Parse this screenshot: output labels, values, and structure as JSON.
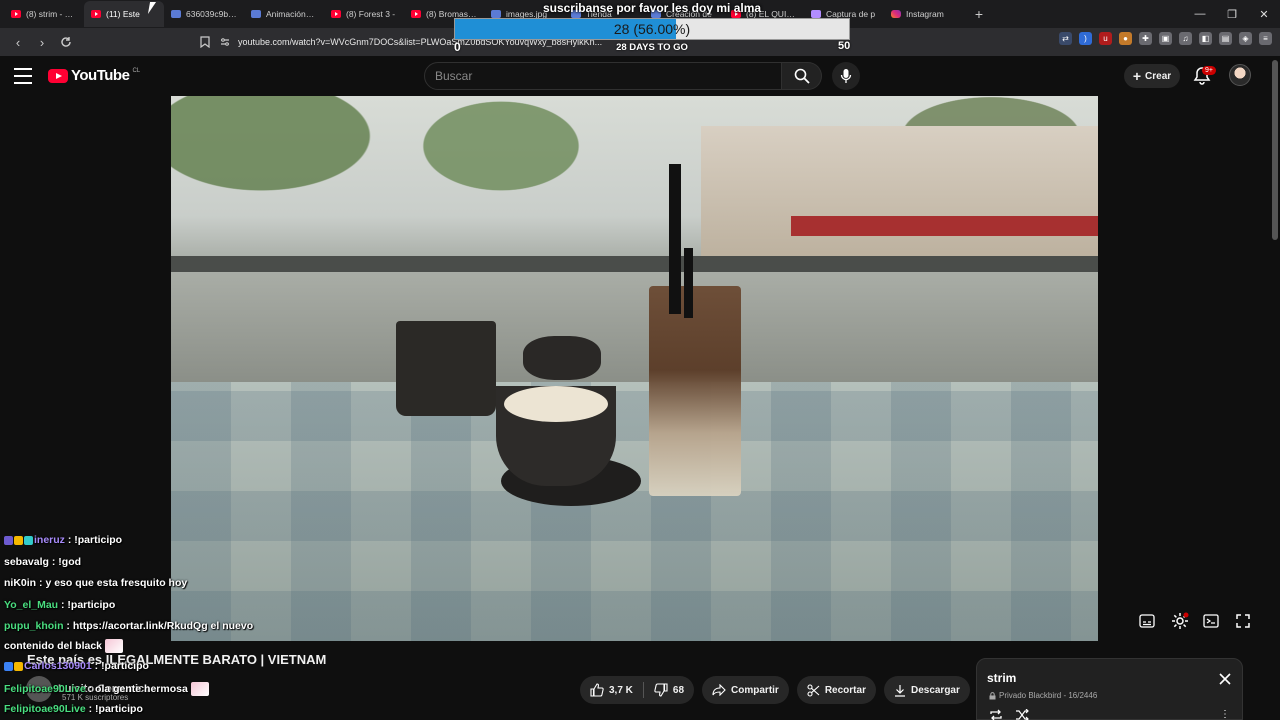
{
  "browser": {
    "tabs": [
      {
        "label": "(8) strim - You",
        "icon": "youtube-icon",
        "active": false
      },
      {
        "label": "(11) Este",
        "icon": "youtube-icon",
        "active": true
      },
      {
        "label": "636039c9b36",
        "icon": "generic-page-icon",
        "active": false
      },
      {
        "label": "Animación_Fr",
        "icon": "generic-page-icon",
        "active": false
      },
      {
        "label": "(8) Forest 3 -",
        "icon": "youtube-icon",
        "active": false
      },
      {
        "label": "(8) Bromas Pe",
        "icon": "youtube-icon",
        "active": false
      },
      {
        "label": "images.jpg",
        "icon": "generic-page-icon",
        "active": false
      },
      {
        "label": "Tienda",
        "icon": "generic-page-icon",
        "active": false
      },
      {
        "label": "Creación de",
        "icon": "generic-page-icon",
        "active": false
      },
      {
        "label": "(8) EL QUISCO",
        "icon": "youtube-icon",
        "active": false
      },
      {
        "label": "Captura de p",
        "icon": "pen-icon",
        "active": false
      },
      {
        "label": "Instagram",
        "icon": "instagram-icon",
        "active": false
      }
    ],
    "new_tab": "+",
    "url": "youtube.com/watch?v=WVcGnm7DOCs&list=PLWOaSmZ0bdSOKYouvqWxy_b8sHyikKn..."
  },
  "overlay": {
    "title": "suscribanse por favor les doy mi alma",
    "progress_text": "28 (56.00%)",
    "progress_fraction": 0.56,
    "min": "0",
    "max": "50",
    "days": "28 DAYS TO GO"
  },
  "youtube": {
    "logo_text": "YouTube",
    "country": "CL",
    "search_placeholder": "Buscar",
    "create_label": "Crear",
    "notifications": "9+"
  },
  "video": {
    "title": "Este país es ILEGALMENTE BARATO | VIETNAM",
    "channel": "Luisito Comunica",
    "subscribers": "571 K suscriptores",
    "likes": "3,7 K",
    "dislikes": "68",
    "share_label": "Compartir",
    "clip_label": "Recortar",
    "download_label": "Descargar"
  },
  "playlist": {
    "title": "strim",
    "meta": "Privado Blackbird - 16/2446"
  },
  "chat": [
    {
      "user": "ineruz",
      "color": "#a78bfa",
      "text": "!participo",
      "badges": [
        "#6d5bd0",
        "#f5b800",
        "#3cc"
      ]
    },
    {
      "user": "sebavalg",
      "color": "#ffffff",
      "text": "!god",
      "badges": []
    },
    {
      "user": "niK0in",
      "color": "#ffffff",
      "text": "y eso que esta fresquito hoy",
      "badges": []
    },
    {
      "user": "Yo_el_Mau",
      "color": "#4ade80",
      "text": "!participo",
      "badges": []
    },
    {
      "user": "pupu_khoin",
      "color": "#4ade80",
      "text": "https://acortar.link/RkudQg el nuevo",
      "badges": []
    },
    {
      "user": "",
      "color": "#ffffff",
      "text": "contenido del black",
      "badges": []
    },
    {
      "user": "Carlos130901",
      "color": "#a78bfa",
      "text": "!participo",
      "badges": [
        "#3b82f6",
        "#f5b800"
      ]
    },
    {
      "user": "Felipitoae90Live",
      "color": "#4ade80",
      "text": "ola gente hermosa",
      "badges": []
    },
    {
      "user": "Felipitoae90Live",
      "color": "#4ade80",
      "text": "!participo",
      "badges": []
    }
  ]
}
